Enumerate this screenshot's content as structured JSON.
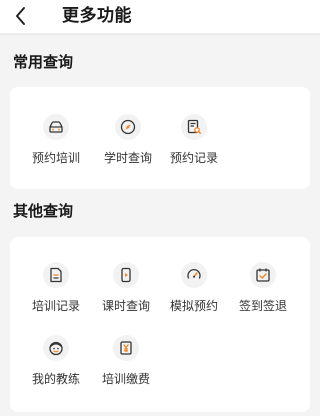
{
  "header": {
    "title": "更多功能"
  },
  "sections": [
    {
      "title": "常用查询",
      "items": [
        {
          "label": "预约培训",
          "icon": "car-icon"
        },
        {
          "label": "学时查询",
          "icon": "compass-icon"
        },
        {
          "label": "预约记录",
          "icon": "record-search-icon"
        }
      ]
    },
    {
      "title": "其他查询",
      "items": [
        {
          "label": "培训记录",
          "icon": "document-icon"
        },
        {
          "label": "课时查询",
          "icon": "video-phone-icon"
        },
        {
          "label": "模拟预约",
          "icon": "speedometer-icon"
        },
        {
          "label": "签到签退",
          "icon": "check-in-icon"
        },
        {
          "label": "我的教练",
          "icon": "coach-face-icon"
        },
        {
          "label": "培训缴费",
          "icon": "payment-icon"
        }
      ]
    }
  ],
  "colors": {
    "accent": "#f0862a",
    "icon_stroke": "#333333",
    "background": "#f4f4f4",
    "card": "#ffffff"
  }
}
